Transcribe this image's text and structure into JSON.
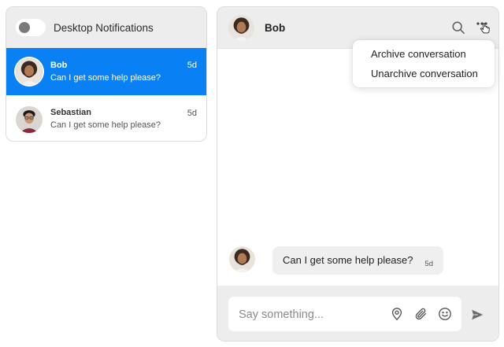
{
  "notifications": {
    "label": "Desktop Notifications",
    "enabled": false
  },
  "conversations": [
    {
      "name": "Bob",
      "preview": "Can I get some help please?",
      "time": "5d",
      "active": true
    },
    {
      "name": "Sebastian",
      "preview": "Can I get some help please?",
      "time": "5d",
      "active": false
    }
  ],
  "chat": {
    "title": "Bob",
    "menu": {
      "items": [
        "Archive conversation",
        "Unarchive conversation"
      ]
    },
    "messages": [
      {
        "text": "Can I get some help please?",
        "time": "5d"
      }
    ],
    "composer": {
      "placeholder": "Say something..."
    }
  },
  "icons": {
    "search": "search-icon",
    "more": "more-horizontal-icon",
    "cursor": "pointer-hand-icon",
    "location": "location-pin-icon",
    "attach": "paperclip-icon",
    "emoji": "smiley-icon",
    "send": "send-icon"
  },
  "colors": {
    "accent": "#0a80f5",
    "panel": "#ededed",
    "bubble": "#efefef"
  }
}
